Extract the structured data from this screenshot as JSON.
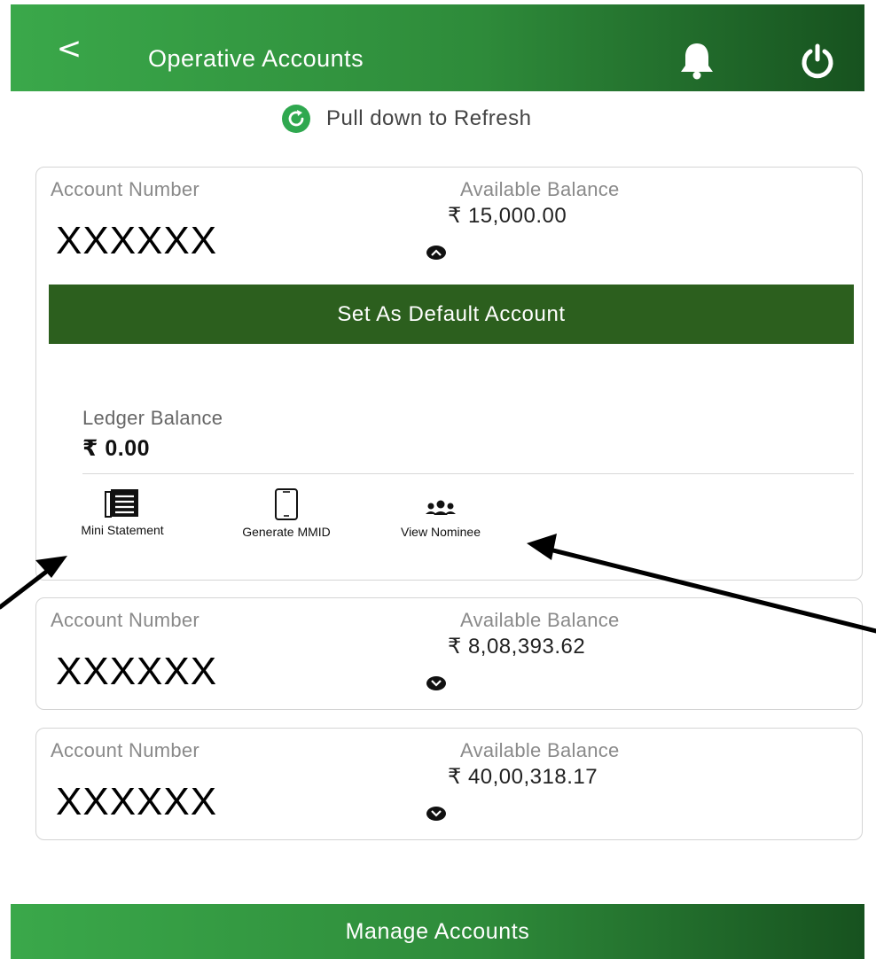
{
  "header": {
    "back_label": "<",
    "title": "Operative Accounts",
    "bell_icon": "bell-icon",
    "power_icon": "power-icon"
  },
  "refresh": {
    "icon": "refresh-icon",
    "text": "Pull down to Refresh"
  },
  "accounts": [
    {
      "number_label": "Account Number",
      "number": "XXXXXX",
      "balance_label": "Available Balance",
      "balance": "₹ 15,000.00",
      "expanded": true,
      "default_button": "Set As Default Account",
      "ledger_label": "Ledger Balance",
      "ledger_balance": "₹ 0.00",
      "actions": [
        {
          "label": "Mini Statement",
          "icon": "statement-icon"
        },
        {
          "label": "Generate MMID",
          "icon": "phone-icon"
        },
        {
          "label": "View Nominee",
          "icon": "people-icon"
        }
      ]
    },
    {
      "number_label": "Account Number",
      "number": "XXXXXX",
      "balance_label": "Available Balance",
      "balance": "₹ 8,08,393.62",
      "expanded": false
    },
    {
      "number_label": "Account Number",
      "number": "XXXXXX",
      "balance_label": "Available Balance",
      "balance": "₹ 40,00,318.17",
      "expanded": false
    }
  ],
  "footer": {
    "manage_button": "Manage Accounts"
  },
  "colors": {
    "header_green": "#2e8b3a",
    "header_dark": "#17521f",
    "default_button_green": "#2c5f1e",
    "refresh_icon_green": "#2fa84f"
  }
}
